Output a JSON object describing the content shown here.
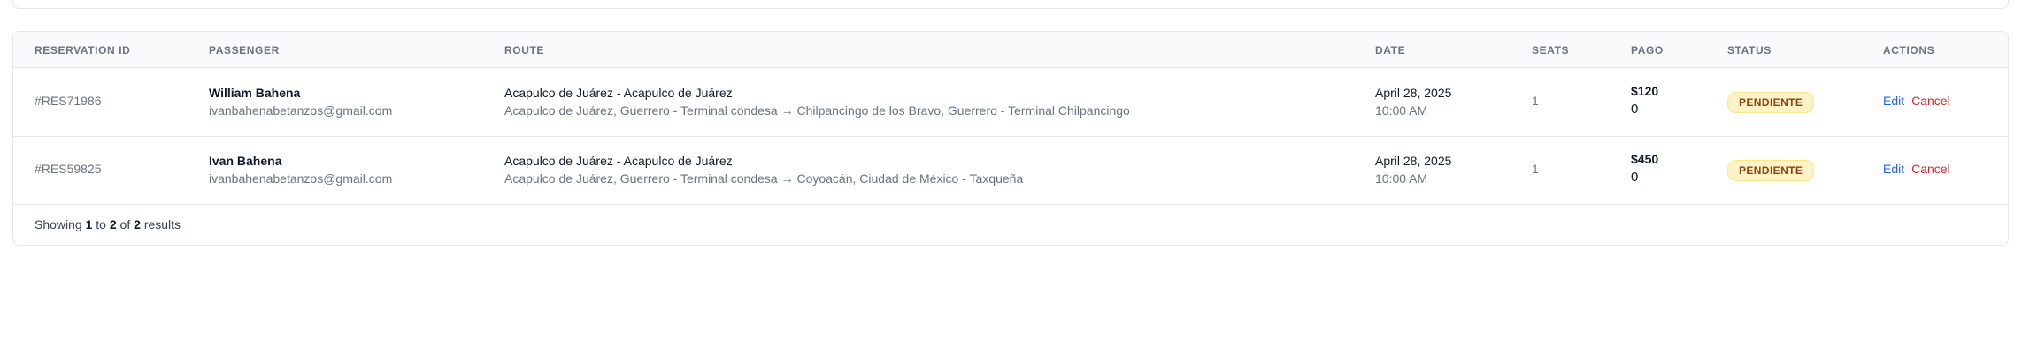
{
  "table": {
    "headers": {
      "reservation_id": "RESERVATION ID",
      "passenger": "PASSENGER",
      "route": "ROUTE",
      "date": "DATE",
      "seats": "SEATS",
      "pago": "PAGO",
      "status": "STATUS",
      "actions": "ACTIONS"
    },
    "rows": [
      {
        "reservation_id": "#RES71986",
        "passenger_name": "William Bahena",
        "passenger_email": "ivanbahenabetanzos@gmail.com",
        "route_title": "Acapulco de Juárez - Acapulco de Juárez",
        "route_detail": "Acapulco de Juárez, Guerrero - Terminal condesa → Chilpancingo de los Bravo, Guerrero - Terminal Chilpancingo",
        "date": "April 28, 2025",
        "time": "10:00 AM",
        "seats": "1",
        "pago_amount": "$120",
        "pago_sub": "0",
        "status": "PENDIENTE",
        "edit_label": "Edit",
        "cancel_label": "Cancel"
      },
      {
        "reservation_id": "#RES59825",
        "passenger_name": "Ivan Bahena",
        "passenger_email": "ivanbahenabetanzos@gmail.com",
        "route_title": "Acapulco de Juárez - Acapulco de Juárez",
        "route_detail": "Acapulco de Juárez, Guerrero - Terminal condesa → Coyoacán, Ciudad de México - Taxqueña",
        "date": "April 28, 2025",
        "time": "10:00 AM",
        "seats": "1",
        "pago_amount": "$450",
        "pago_sub": "0",
        "status": "PENDIENTE",
        "edit_label": "Edit",
        "cancel_label": "Cancel"
      }
    ]
  },
  "pagination": {
    "prefix": "Showing",
    "from": "1",
    "to_word": "to",
    "to": "2",
    "of_word": "of",
    "total": "2",
    "suffix": "results"
  },
  "colors": {
    "status_pending_bg": "#fef3c7",
    "status_pending_text": "#92400e",
    "edit_link": "#2563eb",
    "cancel_link": "#dc2626"
  }
}
